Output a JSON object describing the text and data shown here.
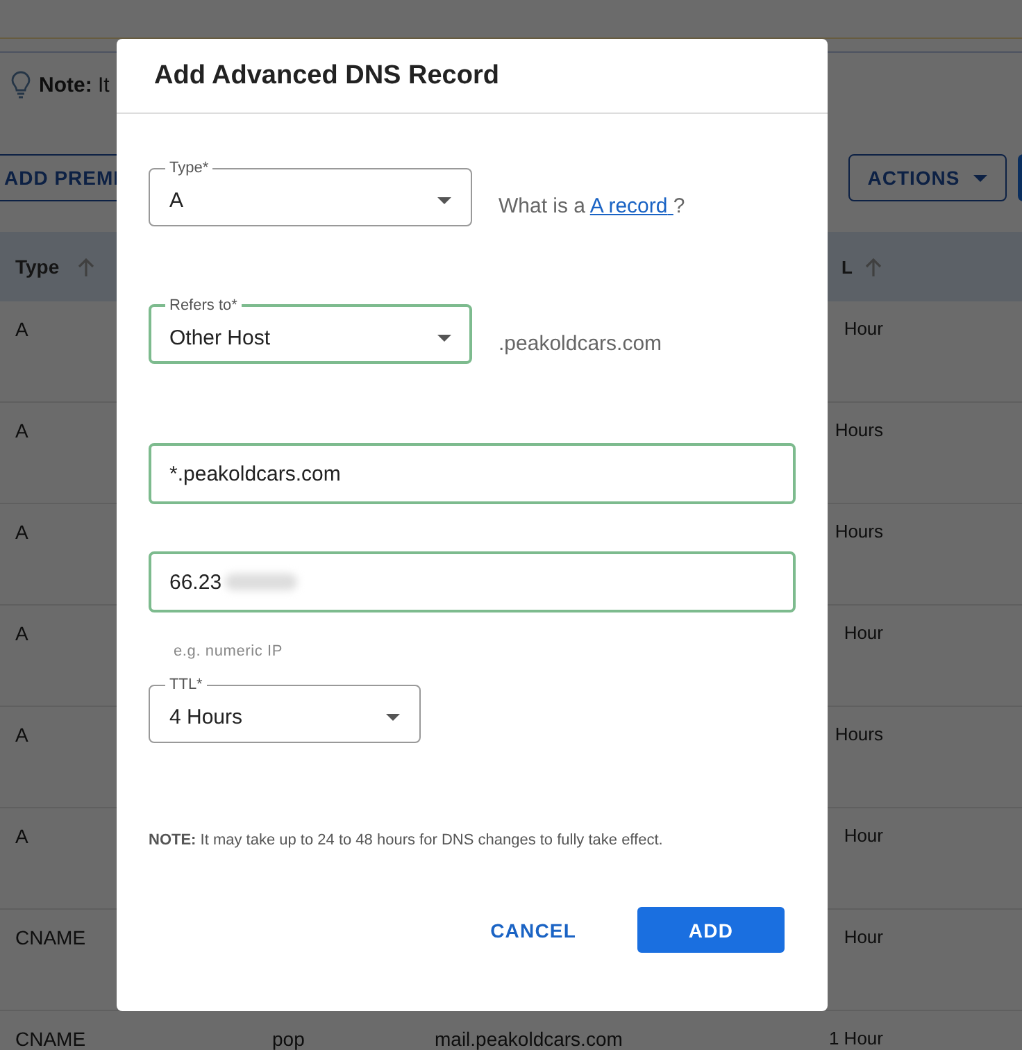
{
  "page": {
    "note": {
      "label": "Note:",
      "text": "It"
    },
    "toolbar": {
      "buttons": [
        "ADD PREMI",
        "ACTIONS"
      ]
    },
    "table": {
      "columns": [
        "Type",
        "L"
      ],
      "rows": [
        {
          "type": "A",
          "ttl": "Hour"
        },
        {
          "type": "A",
          "ttl": "Hours"
        },
        {
          "type": "A",
          "ttl": "Hours"
        },
        {
          "type": "A",
          "ttl": "Hour"
        },
        {
          "type": "A",
          "ttl": "Hours"
        },
        {
          "type": "A",
          "ttl": "Hour"
        },
        {
          "type": "CNAME",
          "ttl": "Hour"
        },
        {
          "type": "CNAME",
          "host": "pop",
          "value": "mail.peakoldcars.com",
          "ttl": "1 Hour"
        }
      ]
    }
  },
  "dialog": {
    "title": "Add Advanced DNS Record",
    "fields": [
      {
        "kind": "select",
        "label": "Type*",
        "value": "A",
        "valid": false,
        "aside": {
          "text": "What is a",
          "link": "A record",
          "after": "?"
        }
      },
      {
        "kind": "select",
        "label": "Refers to*",
        "value": "Other Host",
        "valid": true,
        "aside": {
          "text": ".peakoldcars.com"
        }
      },
      {
        "kind": "input",
        "value": "*.peakoldcars.com",
        "valid": true
      },
      {
        "kind": "input",
        "value": "66.23",
        "redacted": true,
        "valid": true,
        "helper": "e.g. numeric IP"
      },
      {
        "kind": "select",
        "label": "TTL*",
        "value": "4 Hours",
        "valid": false,
        "narrow": true
      }
    ],
    "note": "**NOTE:** It may take up to 24 to 48 hours for DNS changes to fully take effect.",
    "buttons": [
      {
        "kind": "text",
        "label": "CANCEL"
      },
      {
        "kind": "primary",
        "label": "ADD"
      }
    ]
  }
}
